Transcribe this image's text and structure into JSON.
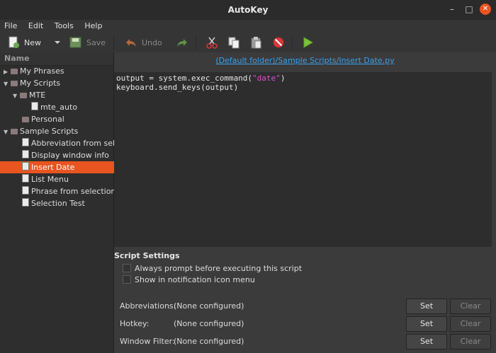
{
  "window": {
    "title": "AutoKey"
  },
  "menu": [
    "File",
    "Edit",
    "Tools",
    "Help"
  ],
  "toolbar": {
    "new_label": "New",
    "save_label": "Save",
    "undo_label": "Undo"
  },
  "tree": {
    "header": "Name",
    "items": [
      {
        "label": "My Phrases"
      },
      {
        "label": "My Scripts"
      },
      {
        "label": "MTE"
      },
      {
        "label": "mte_auto"
      },
      {
        "label": "Personal"
      },
      {
        "label": "Sample Scripts"
      },
      {
        "label": "Abbreviation from selection"
      },
      {
        "label": "Display window info"
      },
      {
        "label": "Insert Date"
      },
      {
        "label": "List Menu"
      },
      {
        "label": "Phrase from selection"
      },
      {
        "label": "Selection Test"
      }
    ]
  },
  "main": {
    "path": "(Default folder)/Sample Scripts/Insert Date.py",
    "code": {
      "line1_a": "output = system.exec_command(",
      "line1_str": "\"date\"",
      "line1_b": ")",
      "line2": "keyboard.send_keys(output)"
    },
    "settings_title": "Script Settings",
    "check_always": "Always prompt before executing this script",
    "check_notify": "Show in notification icon menu",
    "abbr_label": "Abbreviations:",
    "abbr_value": "(None configured)",
    "hotkey_label": "Hotkey:",
    "hotkey_value": "(None configured)",
    "filter_label": "Window Filter:",
    "filter_value": "(None configured)",
    "set_label": "Set",
    "clear_label": "Clear"
  }
}
